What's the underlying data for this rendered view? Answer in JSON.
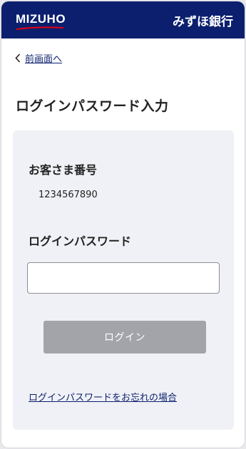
{
  "header": {
    "logo_text": "MIZUHO",
    "bank_name": "みずほ銀行"
  },
  "nav": {
    "back_label": "前画面へ"
  },
  "page": {
    "title": "ログインパスワード入力"
  },
  "form": {
    "customer_number_label": "お客さま番号",
    "customer_number_value": "1234567890",
    "password_label": "ログインパスワード",
    "password_value": "",
    "login_button_label": "ログイン",
    "forgot_link_label": "ログインパスワードをお忘れの場合"
  },
  "colors": {
    "brand_navy": "#0b1f6e",
    "brand_red": "#e60012",
    "disabled_button": "#a3a4a9",
    "panel_bg": "#f0f1f6"
  },
  "icons": {
    "back": "chevron-left-icon",
    "logo": "mizuho-logo"
  }
}
